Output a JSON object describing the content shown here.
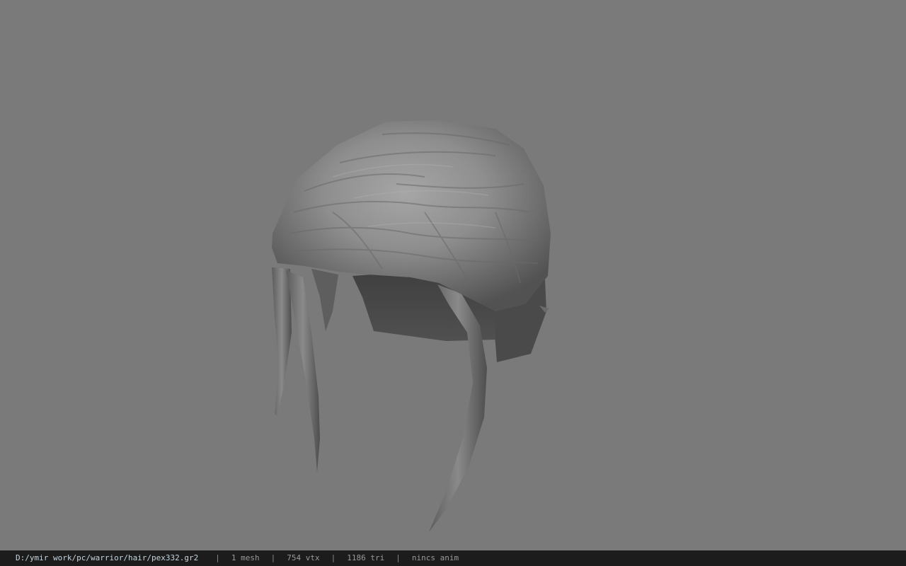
{
  "viewport": {
    "background": "#7a7a7a",
    "model": "hair-mesh"
  },
  "statusbar": {
    "path": "D:/ymir work/pc/warrior/hair/pex332.gr2",
    "separator": "|",
    "mesh": "1 mesh",
    "vertices": "754 vtx",
    "triangles": "1186 tri",
    "animation": "nincs anim"
  }
}
